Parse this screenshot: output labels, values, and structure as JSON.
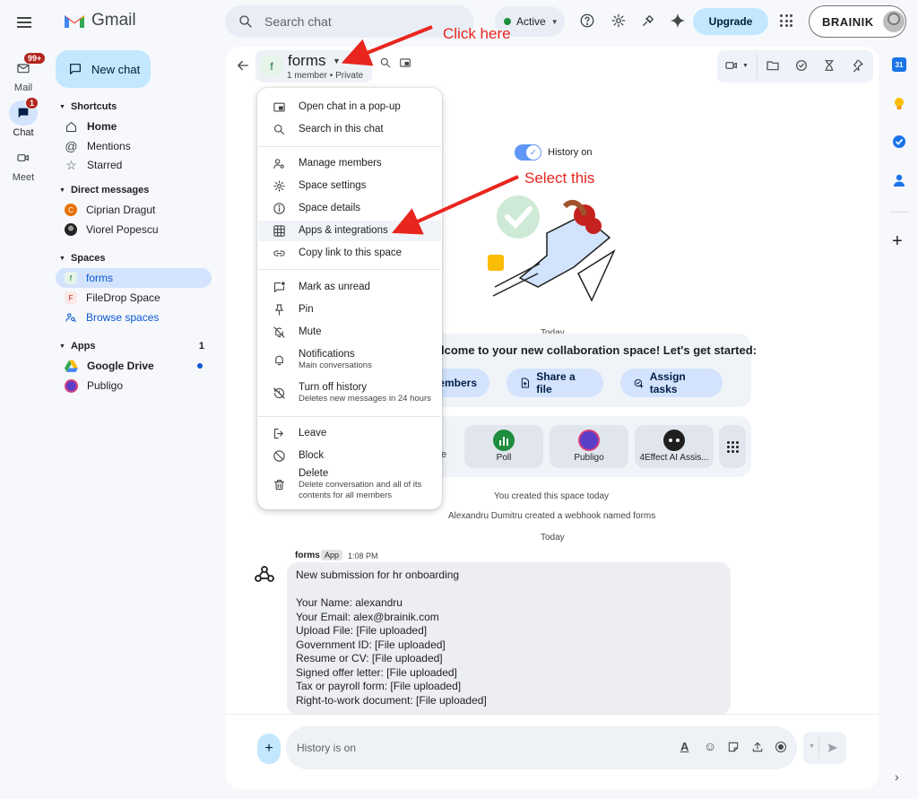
{
  "app": {
    "name": "Gmail"
  },
  "rail": {
    "mail": {
      "label": "Mail",
      "badge": "99+"
    },
    "chat": {
      "label": "Chat",
      "badge": "1"
    },
    "meet": {
      "label": "Meet"
    }
  },
  "header": {
    "search_placeholder": "Search chat",
    "status": "Active",
    "upgrade": "Upgrade",
    "org": "BRAINIK"
  },
  "sidebar": {
    "new_chat": "New chat",
    "shortcuts": {
      "title": "Shortcuts",
      "items": [
        "Home",
        "Mentions",
        "Starred"
      ]
    },
    "direct": {
      "title": "Direct messages",
      "items": [
        "Ciprian Dragut",
        "Viorel Popescu"
      ]
    },
    "spaces": {
      "title": "Spaces",
      "items": [
        "forms",
        "FileDrop Space",
        "Browse spaces"
      ]
    },
    "apps": {
      "title": "Apps",
      "count": "1",
      "items": [
        "Google Drive",
        "Publigo"
      ]
    }
  },
  "chat": {
    "space_letter": "f",
    "title": "forms",
    "meta": "1 member • Private",
    "history": "History on",
    "today1": "Today",
    "welcome": "lcome to your new collaboration space! Let's get started:",
    "add_members": "embers",
    "share_file": "Share a file",
    "assign_tasks": "Assign tasks",
    "apps_left": "e",
    "app_tiles": [
      "Poll",
      "Publigo",
      "4Effect AI Assis..."
    ],
    "created": "You created this space today",
    "webhook": "Alexandru Dumitru created a webhook named forms",
    "today2": "Today",
    "sender": "forms",
    "app_badge": "App",
    "time": "1:08 PM",
    "message_lines": [
      "New submission for hr onboarding",
      "",
      "Your Name: alexandru",
      "Your Email: alex@brainik.com",
      "Upload File: [File uploaded]",
      "Government ID: [File uploaded]",
      "Resume or CV: [File uploaded]",
      "Signed offer letter: [File uploaded]",
      "Tax or payroll form: [File uploaded]",
      "Right-to-work document: [File uploaded]"
    ],
    "composer_placeholder": "History is on"
  },
  "menu": {
    "popup": "Open chat in a pop-up",
    "search": "Search in this chat",
    "manage": "Manage members",
    "settings": "Space settings",
    "details": "Space details",
    "apps": "Apps & integrations",
    "copy_link": "Copy link to this space",
    "mark_unread": "Mark as unread",
    "pin": "Pin",
    "mute": "Mute",
    "notifications": "Notifications",
    "notifications_sub": "Main conversations",
    "history_off": "Turn off history",
    "history_off_sub": "Deletes new messages in 24 hours",
    "leave": "Leave",
    "block": "Block",
    "delete": "Delete",
    "delete_sub": "Delete conversation and all of its contents for all members"
  },
  "annotations": {
    "click_here": "Click here",
    "select_this": "Select this"
  },
  "colors": {
    "accent": "#0b57d0",
    "selected_bg": "#d3e3fd",
    "annotation": "#e8261e"
  }
}
